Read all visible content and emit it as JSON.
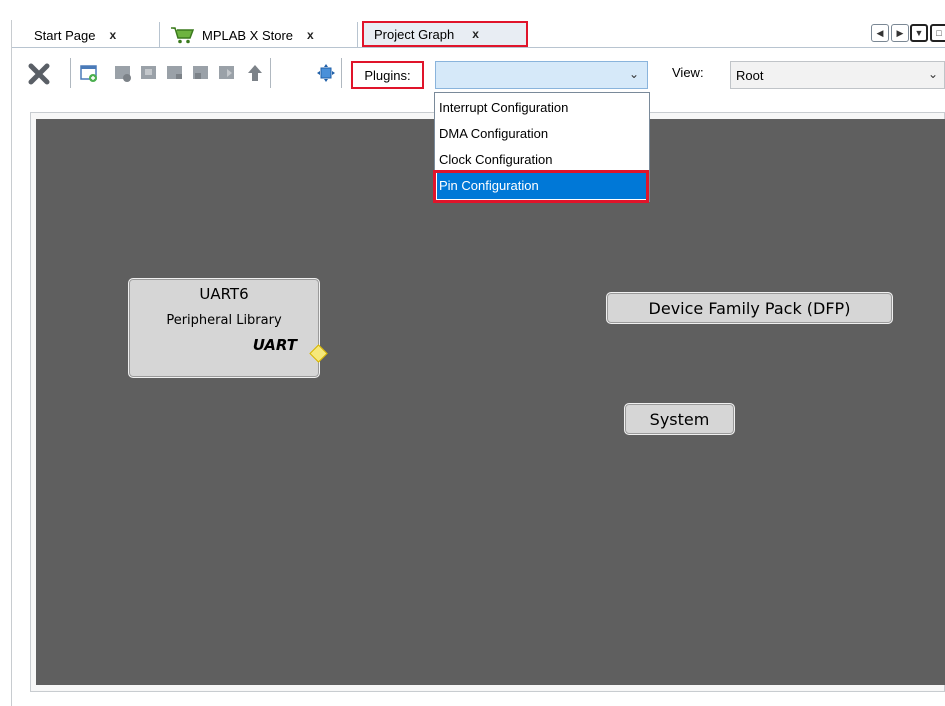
{
  "tabs": [
    {
      "label": "Start Page",
      "close": "x"
    },
    {
      "label": "MPLAB X Store",
      "close": "x",
      "icon": "cart-icon"
    },
    {
      "label": "Project Graph",
      "close": "x",
      "active": true
    }
  ],
  "toolbar": {
    "plugins_label": "Plugins:",
    "plugins_value": "",
    "view_label": "View:",
    "view_value": "Root"
  },
  "plugins_dropdown": {
    "options": [
      {
        "label": "Interrupt Configuration",
        "selected": false
      },
      {
        "label": "DMA Configuration",
        "selected": false
      },
      {
        "label": "Clock Configuration",
        "selected": false
      },
      {
        "label": "Pin Configuration",
        "selected": true
      }
    ]
  },
  "graph": {
    "nodes": [
      {
        "title": "UART6",
        "subtitle": "Peripheral Library",
        "interface": "UART"
      },
      {
        "title": "Device Family Pack (DFP)"
      },
      {
        "title": "System"
      }
    ]
  },
  "colors": {
    "highlight": "#e0142a",
    "canvas": "#5f5f5f",
    "selection": "#0078d7",
    "combo": "#d6e9f9"
  }
}
